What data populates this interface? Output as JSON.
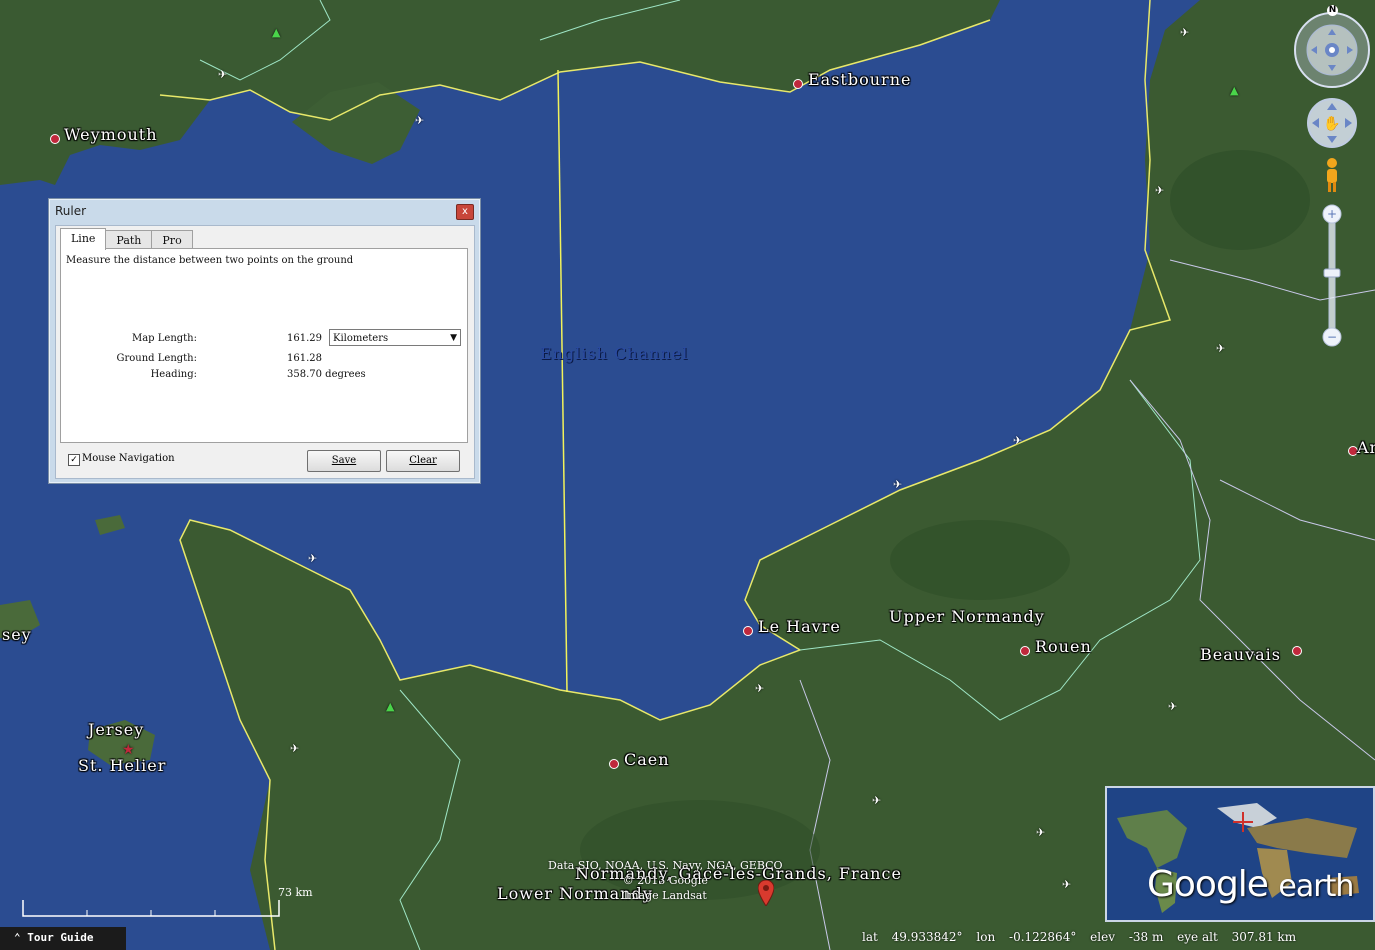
{
  "map": {
    "sea_label": "English Channel",
    "places": [
      {
        "name": "Eastbourne",
        "key": "eastbourne"
      },
      {
        "name": "Weymouth",
        "key": "weymouth"
      },
      {
        "name": "Jersey",
        "key": "jersey"
      },
      {
        "name": "St. Helier",
        "key": "st-helier"
      },
      {
        "name": "Le Havre",
        "key": "le-havre"
      },
      {
        "name": "Upper Normandy",
        "key": "upper-normandy"
      },
      {
        "name": "Rouen",
        "key": "rouen"
      },
      {
        "name": "Beauvais",
        "key": "beauvais"
      },
      {
        "name": "Caen",
        "key": "caen"
      },
      {
        "name": "Lower Normandy",
        "key": "lower-normandy"
      },
      {
        "name": "sey",
        "key": "guernsey-partial"
      },
      {
        "name": "Am",
        "key": "amiens-partial"
      }
    ],
    "search_result": "Normandy, Gacé-les-Grands, France",
    "credits": [
      "Data SIO, NOAA, U.S. Navy, NGA, GEBCO",
      "© 2013 Google",
      "Image Landsat"
    ],
    "scale_label": "73 km",
    "compass_letter": "N"
  },
  "ruler": {
    "title": "Ruler",
    "close_label": "x",
    "tabs": [
      "Line",
      "Path",
      "Pro"
    ],
    "description": "Measure the distance between two points on the ground",
    "map_length_label": "Map Length:",
    "map_length_value": "161.29",
    "unit_selected": "Kilometers",
    "ground_length_label": "Ground Length:",
    "ground_length_value": "161.28",
    "heading_label": "Heading:",
    "heading_value": "358.70 degrees",
    "mouse_nav_label": "Mouse Navigation",
    "mouse_nav_checked": "✓",
    "save_label": "Save",
    "clear_label": "Clear"
  },
  "overview": {
    "brand_google": "Google",
    "brand_earth": "earth"
  },
  "status": {
    "tour_guide": "Tour Guide",
    "lat_label": "lat",
    "lat_value": "49.933842°",
    "lon_label": "lon",
    "lon_value": "-0.122864°",
    "elev_label": "elev",
    "elev_value": "-38 m",
    "eye_label": "eye alt",
    "eye_value": "307.81 km"
  }
}
